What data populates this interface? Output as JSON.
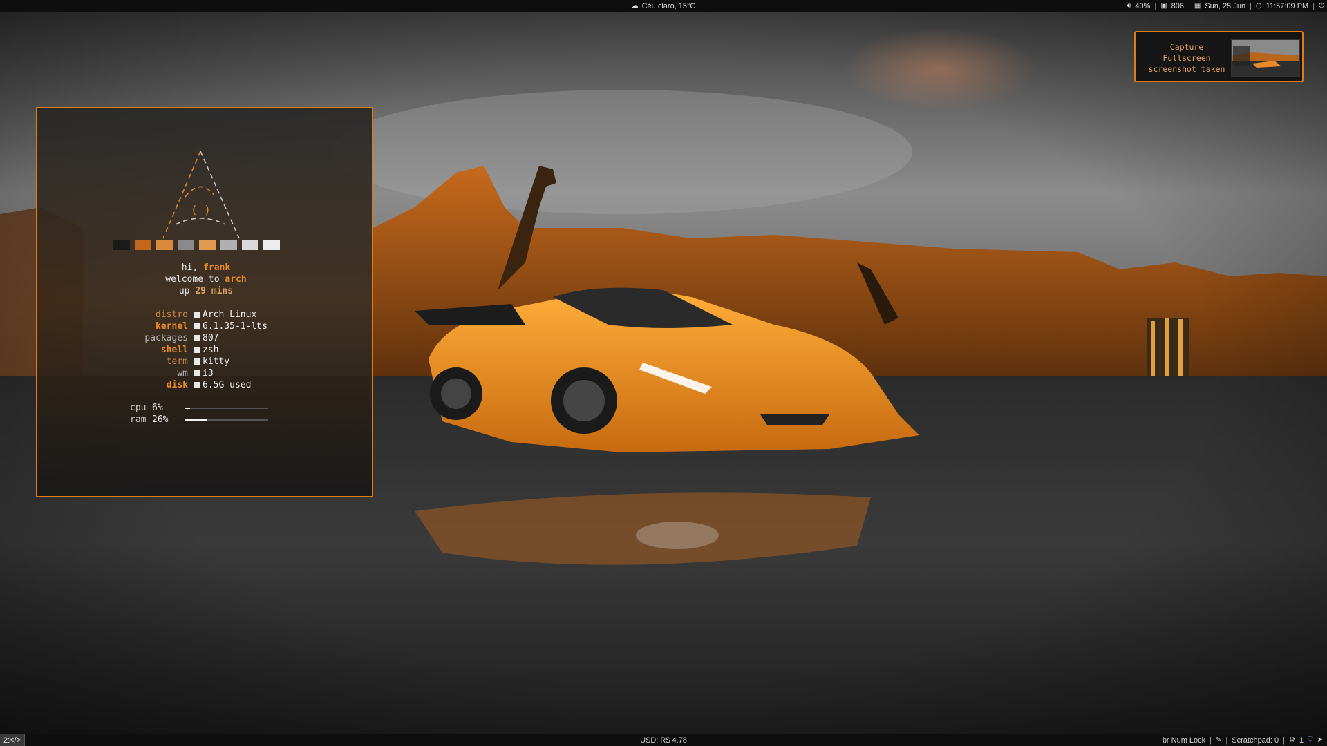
{
  "topbar": {
    "weather": "Céu claro, 15°C",
    "volume": "40%",
    "packages_count": "806",
    "date": "Sun, 25 Jun",
    "time": "11:57:09 PM",
    "icons": [
      "cloud-icon",
      "volume-icon",
      "package-icon",
      "calendar-icon",
      "clock-icon",
      "power-icon"
    ]
  },
  "bottombar": {
    "workspace": "2:</>",
    "currency": "USD: R$ 4.78",
    "keyboard": "br Num Lock",
    "scratchpad": "Scratchpad: 0",
    "tray_count": "1",
    "separator": "|"
  },
  "notification": {
    "line1": "Capture",
    "line2": "Fullscreen",
    "line3": "screenshot taken"
  },
  "terminal": {
    "greeting": {
      "hi": "hi,",
      "user": "frank",
      "welcome": "welcome to",
      "distro_short": "arch",
      "up": "up",
      "uptime_num": "29",
      "uptime_unit": "mins"
    },
    "info": [
      {
        "key": "distro",
        "value": "Arch Linux"
      },
      {
        "key": "kernel",
        "value": "6.1.35-1-lts"
      },
      {
        "key": "packages",
        "value": "807"
      },
      {
        "key": "shell",
        "value": "zsh"
      },
      {
        "key": "term",
        "value": "kitty"
      },
      {
        "key": "wm",
        "value": "i3"
      },
      {
        "key": "disk",
        "value": "6.5G used"
      }
    ],
    "stats": [
      {
        "label": "cpu",
        "percent": "6%",
        "level": 0.06
      },
      {
        "label": "ram",
        "percent": "26%",
        "level": 0.26
      }
    ],
    "palette": [
      "#1a1a1a",
      "#c4661c",
      "#d98a3a",
      "#8a8a8a",
      "#e09a50",
      "#b0b0b0",
      "#d9d9d9",
      "#ededed"
    ]
  },
  "colors": {
    "accent": "#e07b16",
    "bar_bg": "#0e0e0e"
  }
}
